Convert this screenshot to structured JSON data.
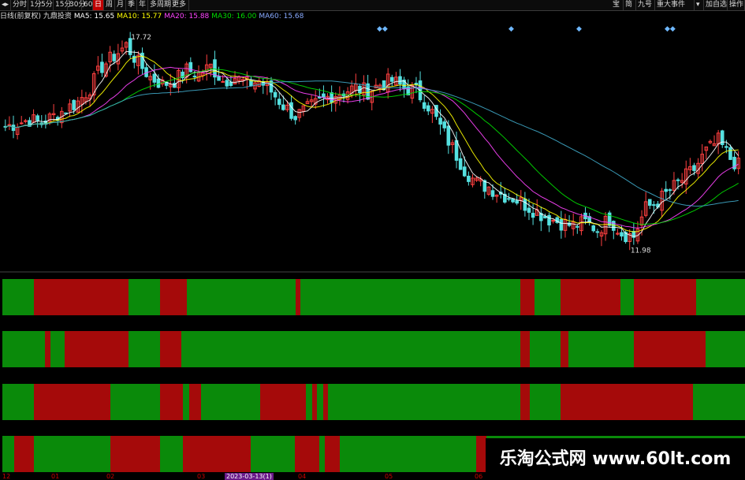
{
  "toolbar": {
    "left": [
      "◂▸",
      "分时",
      "1分",
      "5分",
      "15分",
      "30分",
      "60分",
      "日",
      "周",
      "月",
      "季",
      "年",
      "多周期",
      "更多"
    ],
    "active": "日",
    "right": [
      "宝",
      "简",
      "九号",
      "重大事件",
      "▾",
      "加自选",
      "操作"
    ]
  },
  "legend": {
    "prefix": "日线(前复权)  九鼎投资",
    "items": [
      {
        "label": "MA5",
        "value": "15.65",
        "color": "#ffffff"
      },
      {
        "label": "MA10",
        "value": "15.77",
        "color": "#ffff00"
      },
      {
        "label": "MA20",
        "value": "15.88",
        "color": "#ff44ff"
      },
      {
        "label": "MA30",
        "value": "16.00",
        "color": "#00dd00"
      },
      {
        "label": "MA60",
        "value": "15.68",
        "color": "#88aaff"
      }
    ]
  },
  "chart_data": {
    "type": "candlestick",
    "price_range": [
      11.5,
      18.0
    ],
    "annotations": {
      "high": "17.72",
      "low": "11.98"
    },
    "closes": [
      15.2,
      15.3,
      15.4,
      15.3,
      15.5,
      15.7,
      15.9,
      16.3,
      16.9,
      17.2,
      17.5,
      17.0,
      16.6,
      16.4,
      16.5,
      16.8,
      16.7,
      16.9,
      16.5,
      16.6,
      16.4,
      16.5,
      16.2,
      15.8,
      15.5,
      15.7,
      15.9,
      16.1,
      16.2,
      16.3,
      16.2,
      16.4,
      16.5,
      16.3,
      16.2,
      15.8,
      15.2,
      14.6,
      14.0,
      13.6,
      13.5,
      13.3,
      13.2,
      13.0,
      12.8,
      12.6,
      12.5,
      12.4,
      12.5,
      12.3,
      12.6,
      12.2,
      12.1,
      12.9,
      13.1,
      13.4,
      13.7,
      14.0,
      14.5,
      14.8,
      14.3,
      14.0
    ],
    "ma_colors": [
      "#ffffff",
      "#ffff00",
      "#ff44ff",
      "#00dd00",
      "#3fa8c8"
    ],
    "markers": [
      "◆◆",
      "◆",
      "◆",
      "◆◆"
    ]
  },
  "signal_bars": {
    "colors": {
      "G": "#0a8a0a",
      "R": "#a50a0a"
    },
    "rows": [
      [
        [
          "G",
          0,
          0.042
        ],
        [
          "R",
          0.042,
          0.17
        ],
        [
          "G",
          0.17,
          0.212
        ],
        [
          "R",
          0.212,
          0.248
        ],
        [
          "G",
          0.248,
          0.395
        ],
        [
          "R",
          0.395,
          0.401
        ],
        [
          "G",
          0.401,
          0.697
        ],
        [
          "R",
          0.697,
          0.717
        ],
        [
          "G",
          0.717,
          0.752
        ],
        [
          "R",
          0.752,
          0.832
        ],
        [
          "G",
          0.832,
          0.85
        ],
        [
          "R",
          0.85,
          0.934
        ],
        [
          "G",
          0.934,
          1
        ]
      ],
      [
        [
          "G",
          0,
          0.057
        ],
        [
          "R",
          0.057,
          0.065
        ],
        [
          "G",
          0.065,
          0.084
        ],
        [
          "R",
          0.084,
          0.17
        ],
        [
          "G",
          0.17,
          0.212
        ],
        [
          "R",
          0.212,
          0.241
        ],
        [
          "G",
          0.241,
          0.697
        ],
        [
          "R",
          0.697,
          0.71
        ],
        [
          "G",
          0.71,
          0.752
        ],
        [
          "R",
          0.752,
          0.762
        ],
        [
          "G",
          0.762,
          0.85
        ],
        [
          "R",
          0.85,
          0.947
        ],
        [
          "G",
          0.947,
          1
        ]
      ],
      [
        [
          "G",
          0,
          0.042
        ],
        [
          "R",
          0.042,
          0.145
        ],
        [
          "G",
          0.145,
          0.212
        ],
        [
          "R",
          0.212,
          0.243
        ],
        [
          "G",
          0.243,
          0.252
        ],
        [
          "R",
          0.252,
          0.267
        ],
        [
          "G",
          0.267,
          0.347
        ],
        [
          "R",
          0.347,
          0.409
        ],
        [
          "G",
          0.409,
          0.417
        ],
        [
          "R",
          0.417,
          0.424
        ],
        [
          "G",
          0.424,
          0.432
        ],
        [
          "R",
          0.432,
          0.438
        ],
        [
          "G",
          0.438,
          0.697
        ],
        [
          "R",
          0.697,
          0.71
        ],
        [
          "G",
          0.71,
          0.752
        ],
        [
          "R",
          0.752,
          0.93
        ],
        [
          "G",
          0.93,
          1
        ]
      ],
      [
        [
          "G",
          0,
          0.016
        ],
        [
          "R",
          0.016,
          0.042
        ],
        [
          "G",
          0.042,
          0.145
        ],
        [
          "R",
          0.145,
          0.212
        ],
        [
          "G",
          0.212,
          0.243
        ],
        [
          "R",
          0.243,
          0.334
        ],
        [
          "G",
          0.334,
          0.394
        ],
        [
          "R",
          0.394,
          0.427
        ],
        [
          "G",
          0.427,
          0.434
        ],
        [
          "R",
          0.434,
          0.454
        ],
        [
          "G",
          0.454,
          0.638
        ],
        [
          "R",
          0.638,
          0.652
        ],
        [
          "G",
          0.652,
          1
        ]
      ]
    ]
  },
  "axis": {
    "labels": [
      "12",
      "01",
      "02",
      "03",
      "2023-03-13(1)",
      "04",
      "05",
      "06"
    ],
    "highlight_index": 4
  },
  "watermark": "乐淘公式网 www.60lt.com"
}
